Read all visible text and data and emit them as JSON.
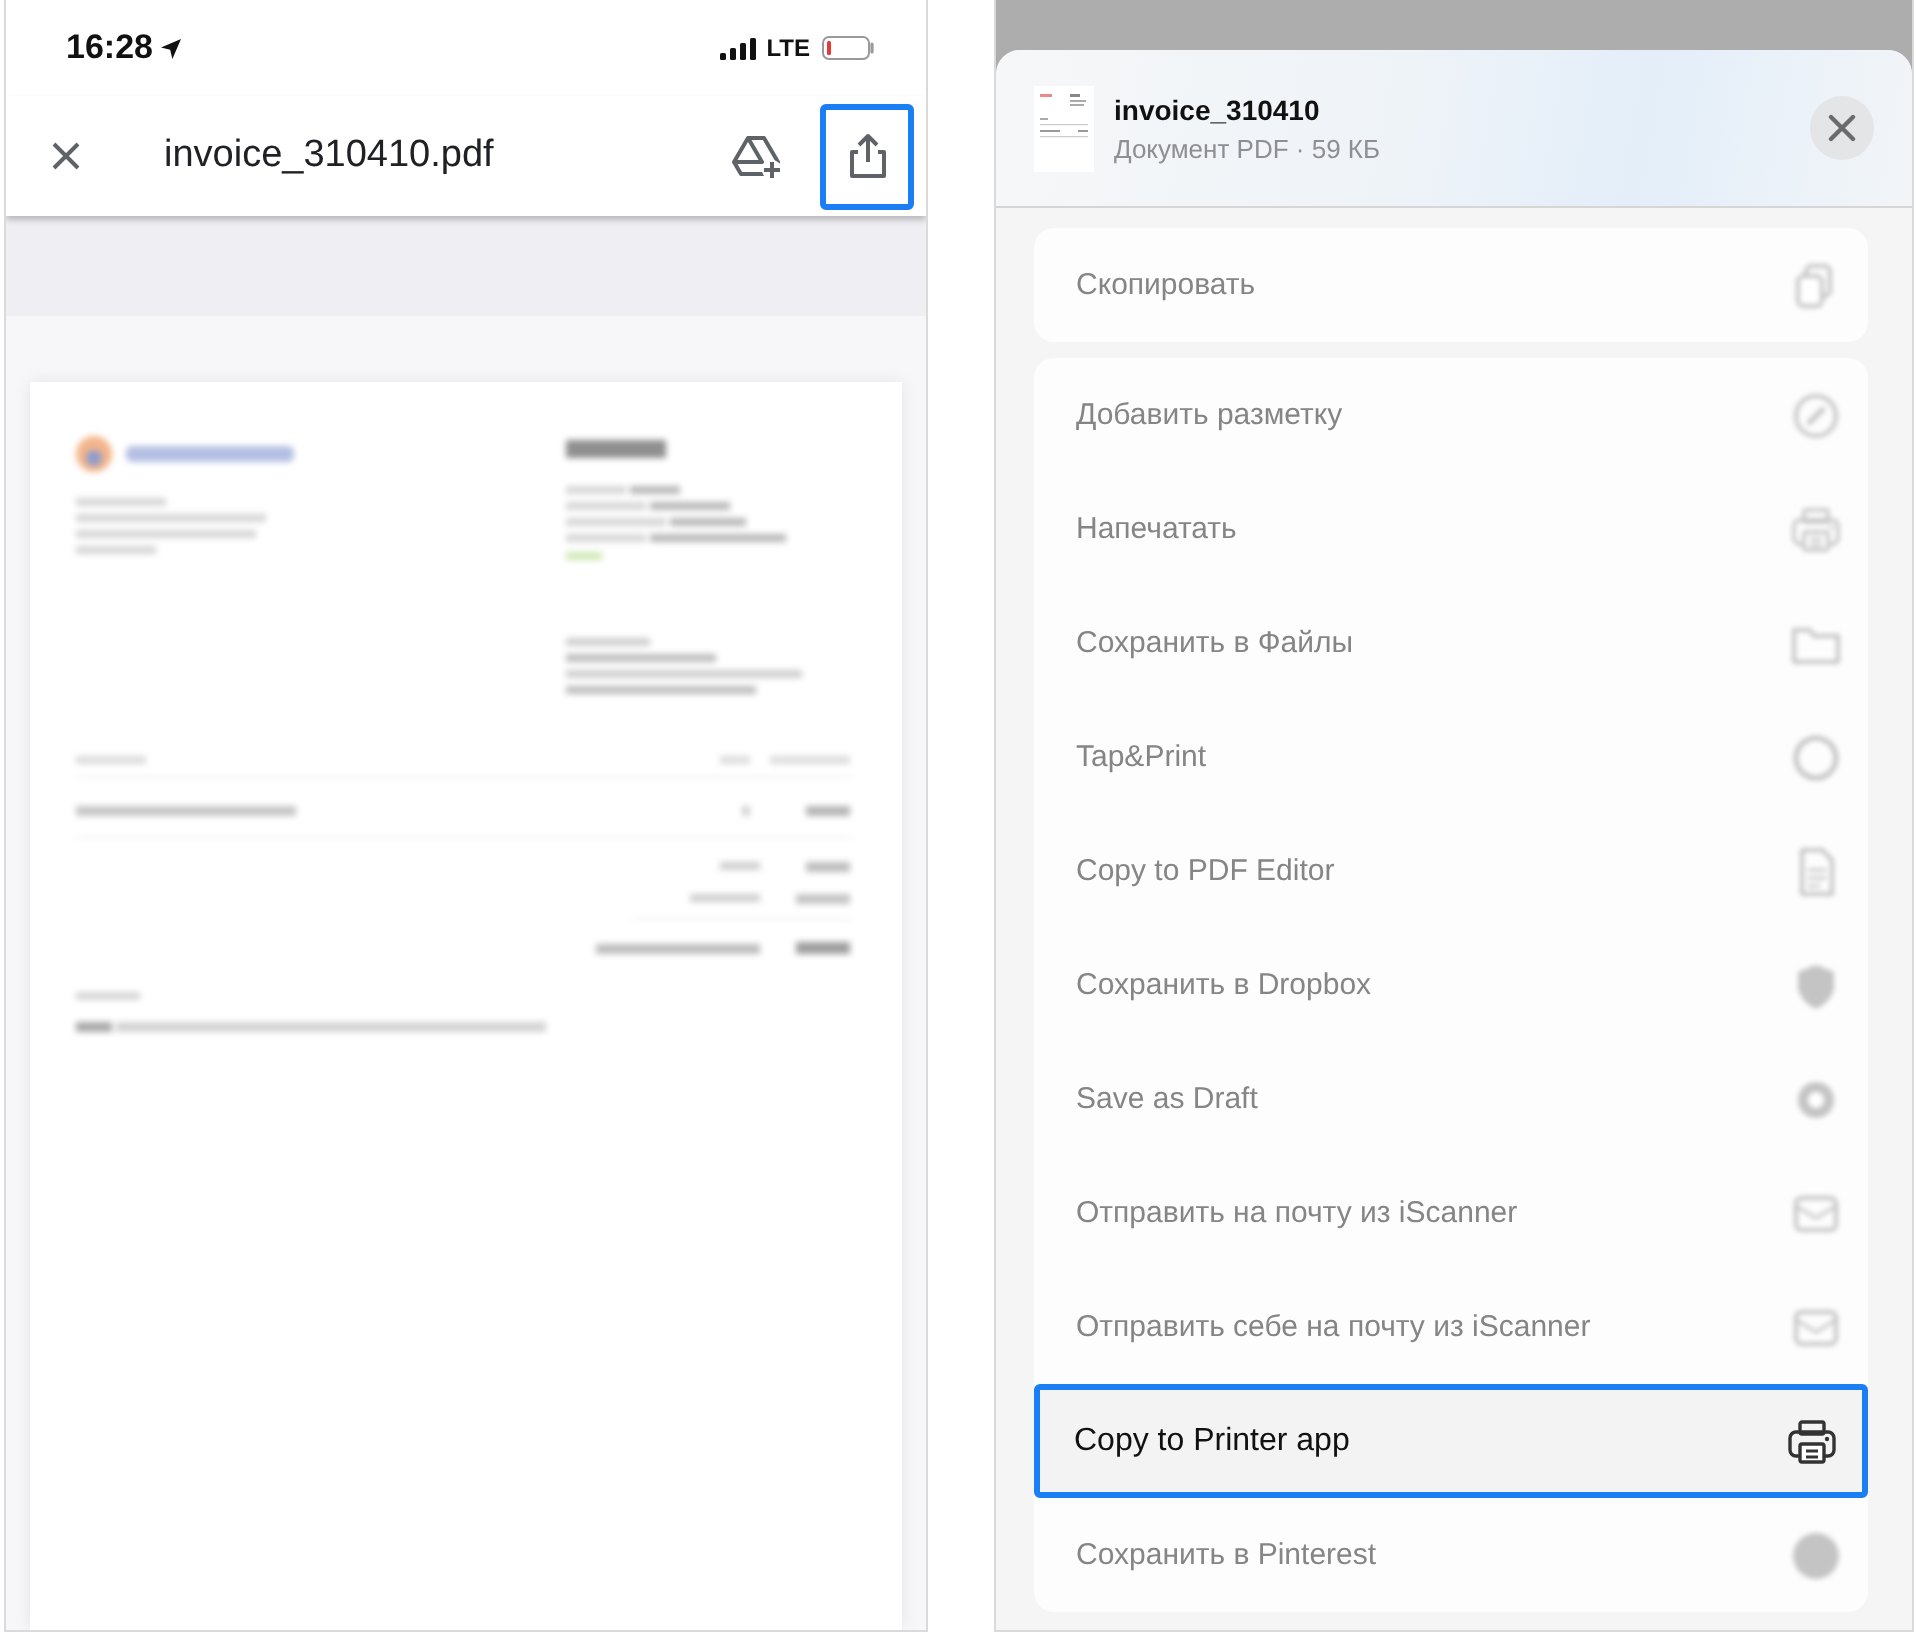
{
  "viewer": {
    "status_bar": {
      "time": "16:28",
      "network": "LTE"
    },
    "toolbar": {
      "title": "invoice_310410.pdf",
      "actions": [
        {
          "kind": "drive",
          "highlighted": false
        },
        {
          "kind": "share",
          "highlighted": true
        }
      ]
    }
  },
  "share_sheet": {
    "file": {
      "name": "invoice_310410",
      "details": "Документ PDF · 59 КБ"
    },
    "groups": [
      {
        "items": [
          {
            "label": "Скопировать",
            "kind": "copy",
            "dimmed": true,
            "highlighted": false
          }
        ]
      },
      {
        "items": [
          {
            "label": "Добавить разметку",
            "kind": "markup",
            "dimmed": true,
            "highlighted": false
          },
          {
            "label": "Напечатать",
            "kind": "printer",
            "dimmed": true,
            "highlighted": false
          },
          {
            "label": "Сохранить в Файлы",
            "kind": "folder",
            "dimmed": true,
            "highlighted": false
          },
          {
            "label": "Tap&Print",
            "kind": "ring",
            "dimmed": true,
            "highlighted": false
          },
          {
            "label": "Copy to PDF Editor",
            "kind": "document",
            "dimmed": true,
            "highlighted": false
          },
          {
            "label": "Сохранить в Dropbox",
            "kind": "shield",
            "dimmed": true,
            "highlighted": false
          },
          {
            "label": "Save as Draft",
            "kind": "donut",
            "dimmed": true,
            "highlighted": false
          },
          {
            "label": "Отправить на почту из iScanner",
            "kind": "mail",
            "dimmed": true,
            "highlighted": false
          },
          {
            "label": "Отправить себе на почту из iScanner",
            "kind": "mail",
            "dimmed": true,
            "highlighted": false
          },
          {
            "label": "Copy to Printer app",
            "kind": "printer",
            "dimmed": false,
            "highlighted": true
          },
          {
            "label": "Сохранить в Pinterest",
            "kind": "disc",
            "dimmed": true,
            "highlighted": false
          }
        ]
      }
    ]
  }
}
